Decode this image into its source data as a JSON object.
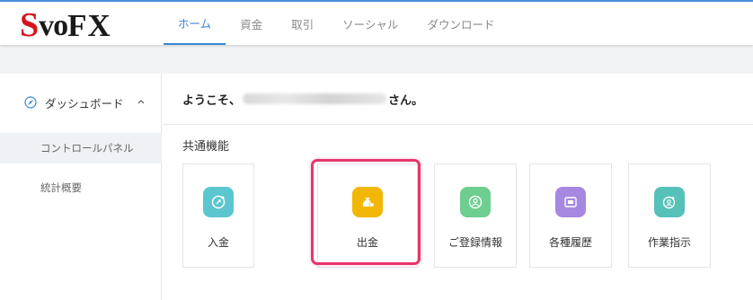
{
  "logo": {
    "s": "S",
    "vo": "vo",
    "fx": "FX"
  },
  "nav": {
    "items": [
      {
        "label": "ホーム"
      },
      {
        "label": "資金"
      },
      {
        "label": "取引"
      },
      {
        "label": "ソーシャル"
      },
      {
        "label": "ダウンロード"
      }
    ]
  },
  "sidebar": {
    "header_label": "ダッシュボード",
    "items": [
      {
        "label": "コントロールパネル"
      },
      {
        "label": "統計概要"
      }
    ]
  },
  "main": {
    "welcome_prefix": "ようこそ、",
    "welcome_suffix": "さん。",
    "section_title": "共通機能",
    "cards": [
      {
        "label": "入金",
        "icon": "deposit-icon",
        "color": "#5bc6cf"
      },
      {
        "label": "出金",
        "icon": "withdrawal-icon",
        "color": "#f2b705"
      },
      {
        "label": "ご登録情報",
        "icon": "profile-icon",
        "color": "#6dce8f"
      },
      {
        "label": "各種履歴",
        "icon": "history-icon",
        "color": "#a688e0"
      },
      {
        "label": "作業指示",
        "icon": "instruction-icon",
        "color": "#56c1b8"
      }
    ]
  },
  "colors": {
    "accent": "#3b86d5",
    "highlight": "#e8356b",
    "brand_red": "#d5151b"
  }
}
